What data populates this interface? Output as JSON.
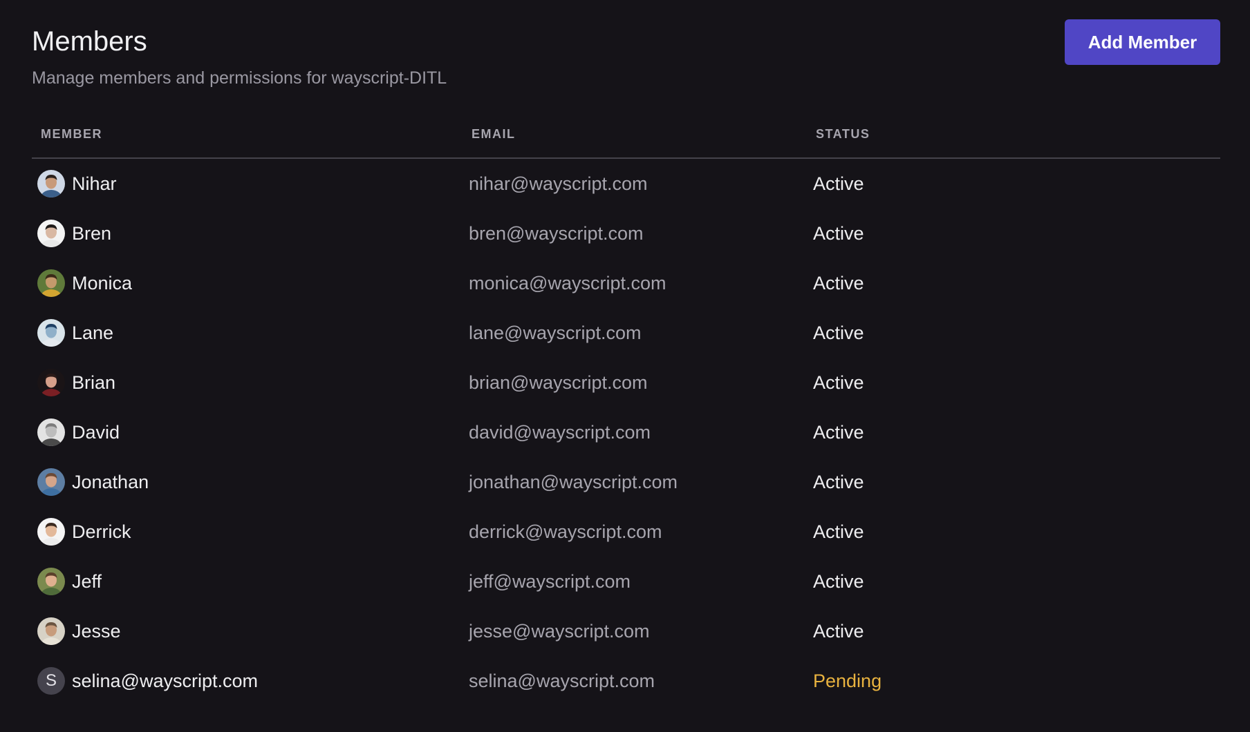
{
  "header": {
    "title": "Members",
    "subtitle": "Manage members and permissions for wayscript-DITL",
    "add_button_label": "Add Member"
  },
  "colors": {
    "accent": "#5046C5",
    "pending": "#E8B23F",
    "background": "#151318"
  },
  "table": {
    "columns": [
      "MEMBER",
      "EMAIL",
      "STATUS"
    ],
    "rows": [
      {
        "name": "Nihar",
        "email": "nihar@wayscript.com",
        "status": "Active",
        "avatar": "photo-avatar"
      },
      {
        "name": "Bren",
        "email": "bren@wayscript.com",
        "status": "Active",
        "avatar": "photo-avatar"
      },
      {
        "name": "Monica",
        "email": "monica@wayscript.com",
        "status": "Active",
        "avatar": "photo-avatar"
      },
      {
        "name": "Lane",
        "email": "lane@wayscript.com",
        "status": "Active",
        "avatar": "photo-avatar"
      },
      {
        "name": "Brian",
        "email": "brian@wayscript.com",
        "status": "Active",
        "avatar": "photo-avatar"
      },
      {
        "name": "David",
        "email": "david@wayscript.com",
        "status": "Active",
        "avatar": "photo-avatar"
      },
      {
        "name": "Jonathan",
        "email": "jonathan@wayscript.com",
        "status": "Active",
        "avatar": "photo-avatar"
      },
      {
        "name": "Derrick",
        "email": "derrick@wayscript.com",
        "status": "Active",
        "avatar": "photo-avatar"
      },
      {
        "name": "Jeff",
        "email": "jeff@wayscript.com",
        "status": "Active",
        "avatar": "photo-avatar"
      },
      {
        "name": "Jesse",
        "email": "jesse@wayscript.com",
        "status": "Active",
        "avatar": "photo-avatar"
      },
      {
        "name": "selina@wayscript.com",
        "email": "selina@wayscript.com",
        "status": "Pending",
        "avatar": "initial-avatar",
        "initial": "S"
      }
    ]
  }
}
